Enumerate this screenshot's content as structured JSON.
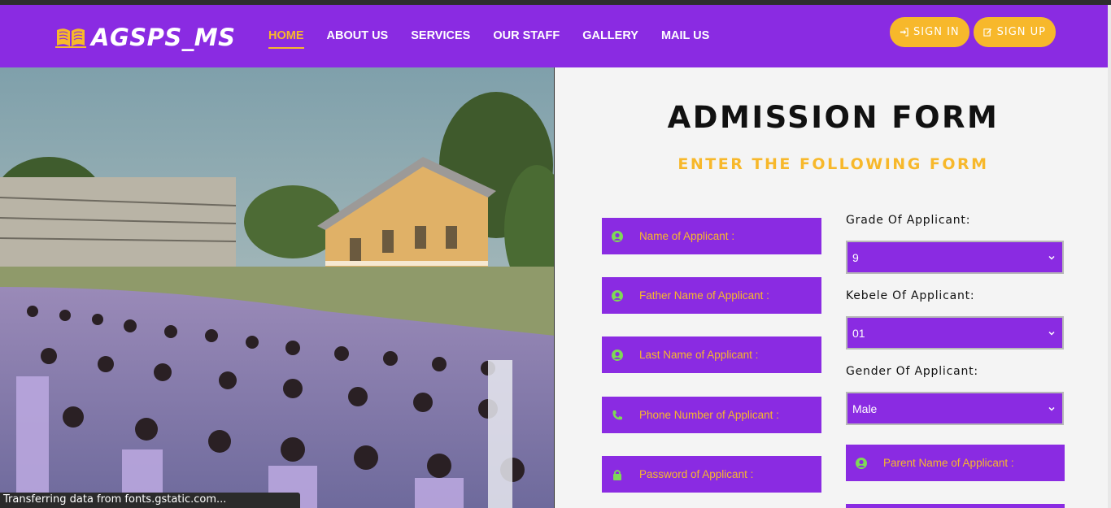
{
  "brand": {
    "name": "AGSPS_MS",
    "icon": "book-icon"
  },
  "nav": [
    {
      "label": "HOME",
      "active": true
    },
    {
      "label": "ABOUT US",
      "active": false
    },
    {
      "label": "SERVICES",
      "active": false
    },
    {
      "label": "OUR STAFF",
      "active": false
    },
    {
      "label": "GALLERY",
      "active": false
    },
    {
      "label": "MAIL US",
      "active": false
    }
  ],
  "auth": {
    "signin": "SIGN IN",
    "signup": "SIGN UP"
  },
  "form": {
    "title": "ADMISSION FORM",
    "subtitle": "ENTER THE FOLLOWING FORM",
    "fields": [
      {
        "placeholder": "Name of Applicant :",
        "icon": "user-icon"
      },
      {
        "placeholder": "Father Name of Applicant :",
        "icon": "user-icon"
      },
      {
        "placeholder": "Last Name of Applicant :",
        "icon": "user-icon"
      },
      {
        "placeholder": "Phone Number of Applicant :",
        "icon": "phone-icon"
      },
      {
        "placeholder": "Password of Applicant :",
        "icon": "lock-icon"
      }
    ],
    "grade": {
      "label": "Grade Of Applicant:",
      "value": "9"
    },
    "kebele": {
      "label": "Kebele Of Applicant:",
      "value": "01"
    },
    "gender": {
      "label": "Gender Of Applicant:",
      "value": "Male"
    },
    "parent": {
      "placeholder": "Parent Name of Applicant :",
      "icon": "user-icon"
    }
  },
  "status": "Transferring data from fonts.gstatic.com...",
  "colors": {
    "purple": "#8a2be2",
    "accent": "#f7b82b",
    "icon_green": "#7ed957"
  }
}
